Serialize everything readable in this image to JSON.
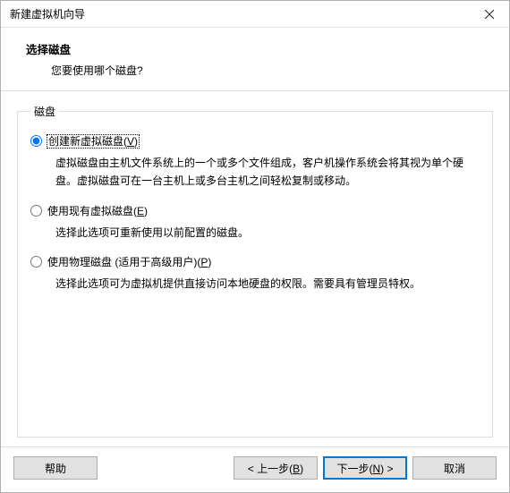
{
  "window": {
    "title": "新建虚拟机向导"
  },
  "header": {
    "title": "选择磁盘",
    "subtitle": "您要使用哪个磁盘?"
  },
  "group": {
    "legend": "磁盘"
  },
  "options": {
    "createNew": {
      "label_pre": "创建新虚拟磁盘(",
      "mnemonic": "V",
      "label_post": ")",
      "selected": true,
      "desc": "虚拟磁盘由主机文件系统上的一个或多个文件组成，客户机操作系统会将其视为单个硬盘。虚拟磁盘可在一台主机上或多台主机之间轻松复制或移动。"
    },
    "useExisting": {
      "label_pre": "使用现有虚拟磁盘(",
      "mnemonic": "E",
      "label_post": ")",
      "selected": false,
      "desc": "选择此选项可重新使用以前配置的磁盘。"
    },
    "usePhysical": {
      "label_pre": "使用物理磁盘 (适用于高级用户)(",
      "mnemonic": "P",
      "label_post": ")",
      "selected": false,
      "desc": "选择此选项可为虚拟机提供直接访问本地硬盘的权限。需要具有管理员特权。"
    }
  },
  "buttons": {
    "help": "帮助",
    "back_pre": "< 上一步(",
    "back_mn": "B",
    "back_post": ")",
    "next_pre": "下一步(",
    "next_mn": "N",
    "next_post": ") >",
    "cancel": "取消"
  }
}
